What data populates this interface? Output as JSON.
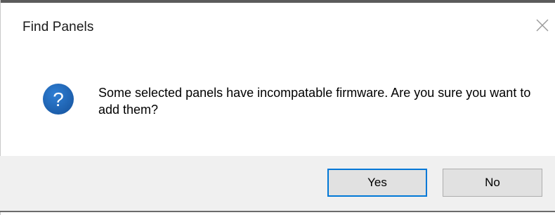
{
  "dialog": {
    "title": "Find Panels",
    "message": "Some selected panels have incompatable firmware. Are you sure you want to add them?",
    "icon": "question-icon",
    "close_icon": "close-icon",
    "buttons": {
      "yes_label": "Yes",
      "no_label": "No"
    },
    "colors": {
      "icon_blue": "#1d64b5",
      "focus_border": "#0078d7",
      "footer_bg": "#f0f0f0",
      "button_bg": "#e1e1e1"
    }
  }
}
